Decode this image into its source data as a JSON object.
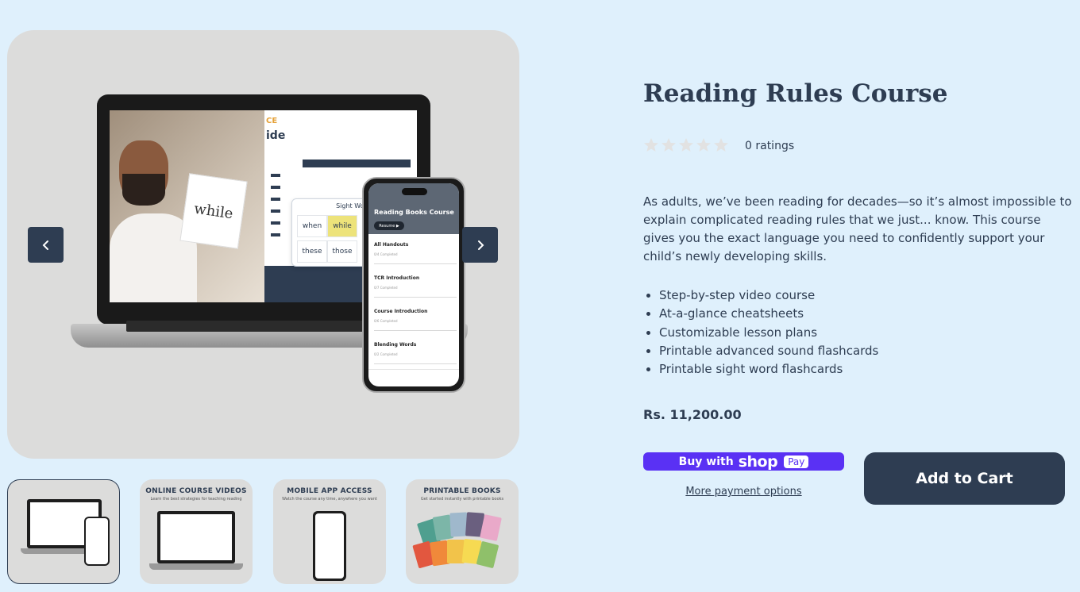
{
  "breadcrumb": {
    "text": "",
    "visible_fragment": ", ..."
  },
  "gallery": {
    "main_image_alt": "Reading Rules Course on laptop and phone",
    "laptop_slide": {
      "accent": "CE",
      "title_fragment": "ide",
      "sight_words_title": "Sight Words",
      "words": [
        "when",
        "while",
        "these",
        "those"
      ],
      "paper_word": "while"
    },
    "phone": {
      "title": "Reading Books Course",
      "resume": "Resume ▶",
      "items": [
        {
          "title": "All Handouts",
          "sub": "0/4 Completed"
        },
        {
          "title": "TCR Introduction",
          "sub": "0/7 Completed"
        },
        {
          "title": "Course Introduction",
          "sub": "0/6 Completed"
        },
        {
          "title": "Blending Words",
          "sub": "0/2 Completed"
        }
      ]
    },
    "thumbnails": [
      {
        "title": "",
        "sub": ""
      },
      {
        "title": "ONLINE COURSE VIDEOS",
        "sub": "Learn the best strategies for teaching reading"
      },
      {
        "title": "MOBILE APP ACCESS",
        "sub": "Watch the course any time, anywhere you want"
      },
      {
        "title": "PRINTABLE BOOKS",
        "sub": "Get started instantly with printable books"
      }
    ]
  },
  "product": {
    "title": "Reading Rules Course",
    "rating": 0,
    "ratings_text": "0 ratings",
    "description": "As adults, we’ve been reading for decades—so it’s almost impossible to explain complicated reading rules that we just... know. This course gives you the exact language you need to confidently support your child’s newly developing skills.",
    "features": [
      "Step-by-step video course",
      "At-a-glance cheatsheets",
      "Customizable lesson plans",
      "Printable advanced sound flashcards",
      "Printable sight word flashcards"
    ],
    "price": "Rs. 11,200.00"
  },
  "actions": {
    "shop_pay_prefix": "Buy with",
    "shop_pay_brand": "shop",
    "shop_pay_pill": "Pay",
    "more_options": "More payment options",
    "add_to_cart": "Add to Cart"
  },
  "colors": {
    "background": "#dff0fc",
    "primary": "#2e3d52",
    "shop_pay": "#5a31f4",
    "star_empty": "#e2e2e2"
  }
}
